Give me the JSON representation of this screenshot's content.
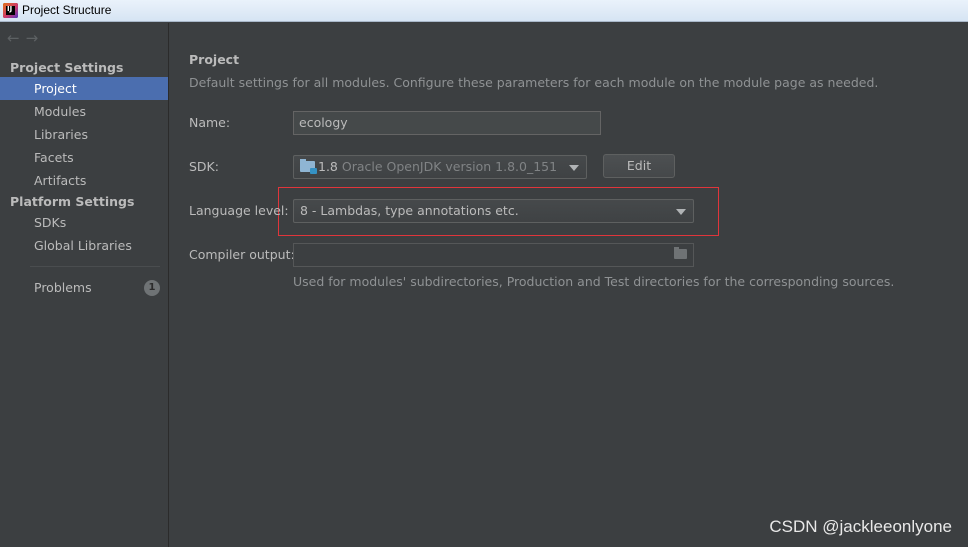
{
  "window": {
    "title": "Project Structure",
    "icon": "intellij-idea-icon"
  },
  "sidebar": {
    "nav": {
      "back": "←",
      "forward": "→"
    },
    "sections": [
      {
        "heading": "Project Settings",
        "items": [
          "Project",
          "Modules",
          "Libraries",
          "Facets",
          "Artifacts"
        ]
      },
      {
        "heading": "Platform Settings",
        "items": [
          "SDKs",
          "Global Libraries"
        ]
      }
    ],
    "selected": "Project",
    "problems": {
      "label": "Problems",
      "count": "1"
    }
  },
  "main": {
    "title": "Project",
    "description": "Default settings for all modules. Configure these parameters for each module on the module page as needed.",
    "name_label": "Name:",
    "name_value": "ecology",
    "sdk_label": "SDK:",
    "sdk_version": "1.8",
    "sdk_name": "Oracle OpenJDK version 1.8.0_151",
    "edit_button": "Edit",
    "language_label": "Language level:",
    "language_value": "8 - Lambdas, type annotations etc.",
    "compiler_label": "Compiler output:",
    "compiler_value": "",
    "compiler_hint": "Used for modules' subdirectories, Production and Test directories for the corresponding sources."
  },
  "watermark": "CSDN @jackleeonlyone",
  "colors": {
    "selection": "#4b6eaf",
    "highlight_border": "#e0353b",
    "background": "#3c3f41"
  }
}
